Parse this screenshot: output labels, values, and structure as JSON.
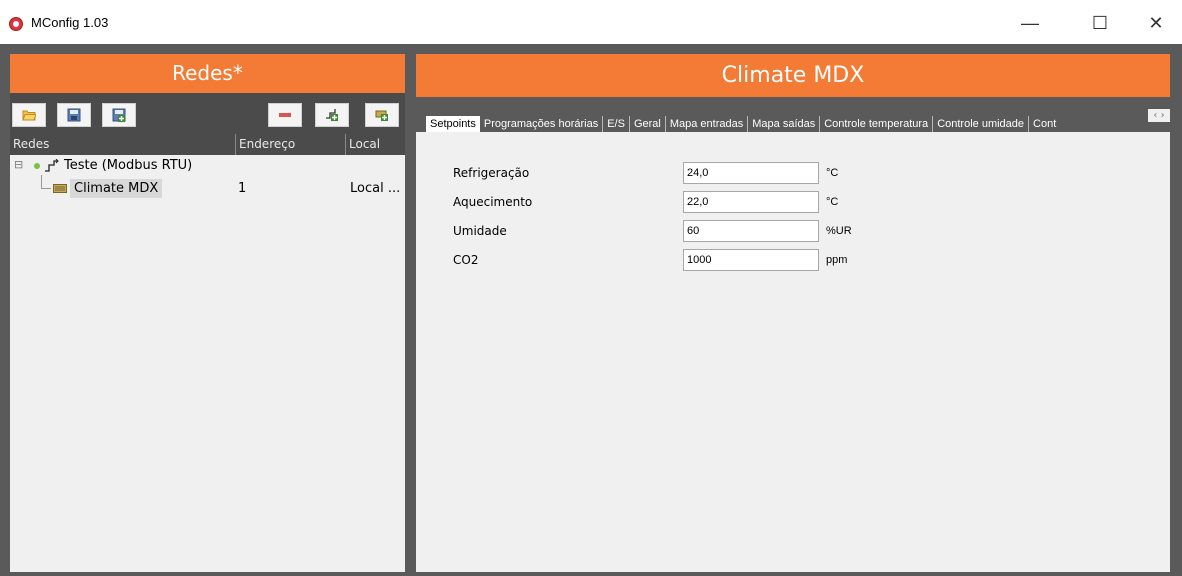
{
  "window": {
    "title": "MConfig 1.03",
    "minimize": "—",
    "maximize": "☐",
    "close": "✕"
  },
  "left_panel": {
    "title": "Redes*",
    "toolbar": [
      {
        "name": "open-folder-icon",
        "color": "#e8a33a"
      },
      {
        "name": "save-icon",
        "color": "#4a6fa5"
      },
      {
        "name": "save-as-icon",
        "color": "#4a6fa5"
      },
      {
        "name": "remove-icon",
        "color": "#d9534f"
      },
      {
        "name": "add-network-icon",
        "color": "#3b8a2f"
      },
      {
        "name": "add-device-icon",
        "color": "#3b8a2f"
      }
    ],
    "columns": [
      "Redes",
      "Endereço",
      "Local"
    ],
    "tree": {
      "network": {
        "expand": "⊟",
        "label": "Teste (Modbus RTU)"
      },
      "device": {
        "label": "Climate MDX",
        "address": "1",
        "local": "Local ..."
      }
    }
  },
  "right_panel": {
    "title": "Climate MDX",
    "tabs": [
      "Setpoints",
      "Programações horárias",
      "E/S",
      "Geral",
      "Mapa entradas",
      "Mapa saídas",
      "Controle temperatura",
      "Controle umidade",
      "Cont"
    ],
    "tab_scroll": "‹ ›",
    "fields": [
      {
        "label": "Refrigeração",
        "value": "24,0",
        "unit": "°C"
      },
      {
        "label": "Aquecimento",
        "value": "22,0",
        "unit": "°C"
      },
      {
        "label": "Umidade",
        "value": "60",
        "unit": "%UR"
      },
      {
        "label": "CO2",
        "value": "1000",
        "unit": "ppm"
      }
    ]
  },
  "colors": {
    "accent": "#f47b35",
    "panel_dark": "#4b4b4b",
    "background_dark": "#5a5a5a"
  }
}
